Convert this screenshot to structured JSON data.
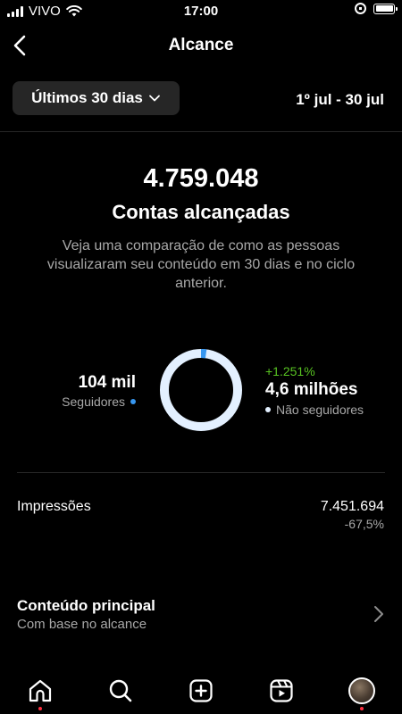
{
  "status_bar": {
    "carrier": "VIVO",
    "time": "17:00",
    "icons": [
      "signal-icon",
      "wifi-icon",
      "orientation-lock-icon",
      "battery-icon"
    ]
  },
  "header": {
    "title": "Alcance",
    "back_icon": "back-arrow-icon"
  },
  "range": {
    "selector_label": "Últimos 30 dias",
    "dates": "1º jul - 30 jul"
  },
  "summary": {
    "value": "4.759.048",
    "label": "Contas alcançadas",
    "description": "Veja uma comparação de como as pessoas visualizaram seu conteúdo em 30 dias e no ciclo anterior."
  },
  "breakdown": {
    "followers": {
      "value": "104 mil",
      "label": "Seguidores",
      "color": "#3797f0",
      "share": 0.022
    },
    "non_followers": {
      "growth": "+1.251%",
      "value": "4,6 milhões",
      "label": "Não seguidores",
      "color": "#e3f0ff",
      "share": 0.978
    },
    "growth_color": "#58c322"
  },
  "impressions": {
    "label": "Impressões",
    "value": "7.451.694",
    "change": "-67,5%"
  },
  "top_content": {
    "title": "Conteúdo principal",
    "subtitle": "Com base no alcance"
  },
  "bottom_nav": {
    "items": [
      "home-icon",
      "search-icon",
      "create-icon",
      "reels-icon",
      "profile-avatar"
    ],
    "notification_color": "#ff3040"
  }
}
